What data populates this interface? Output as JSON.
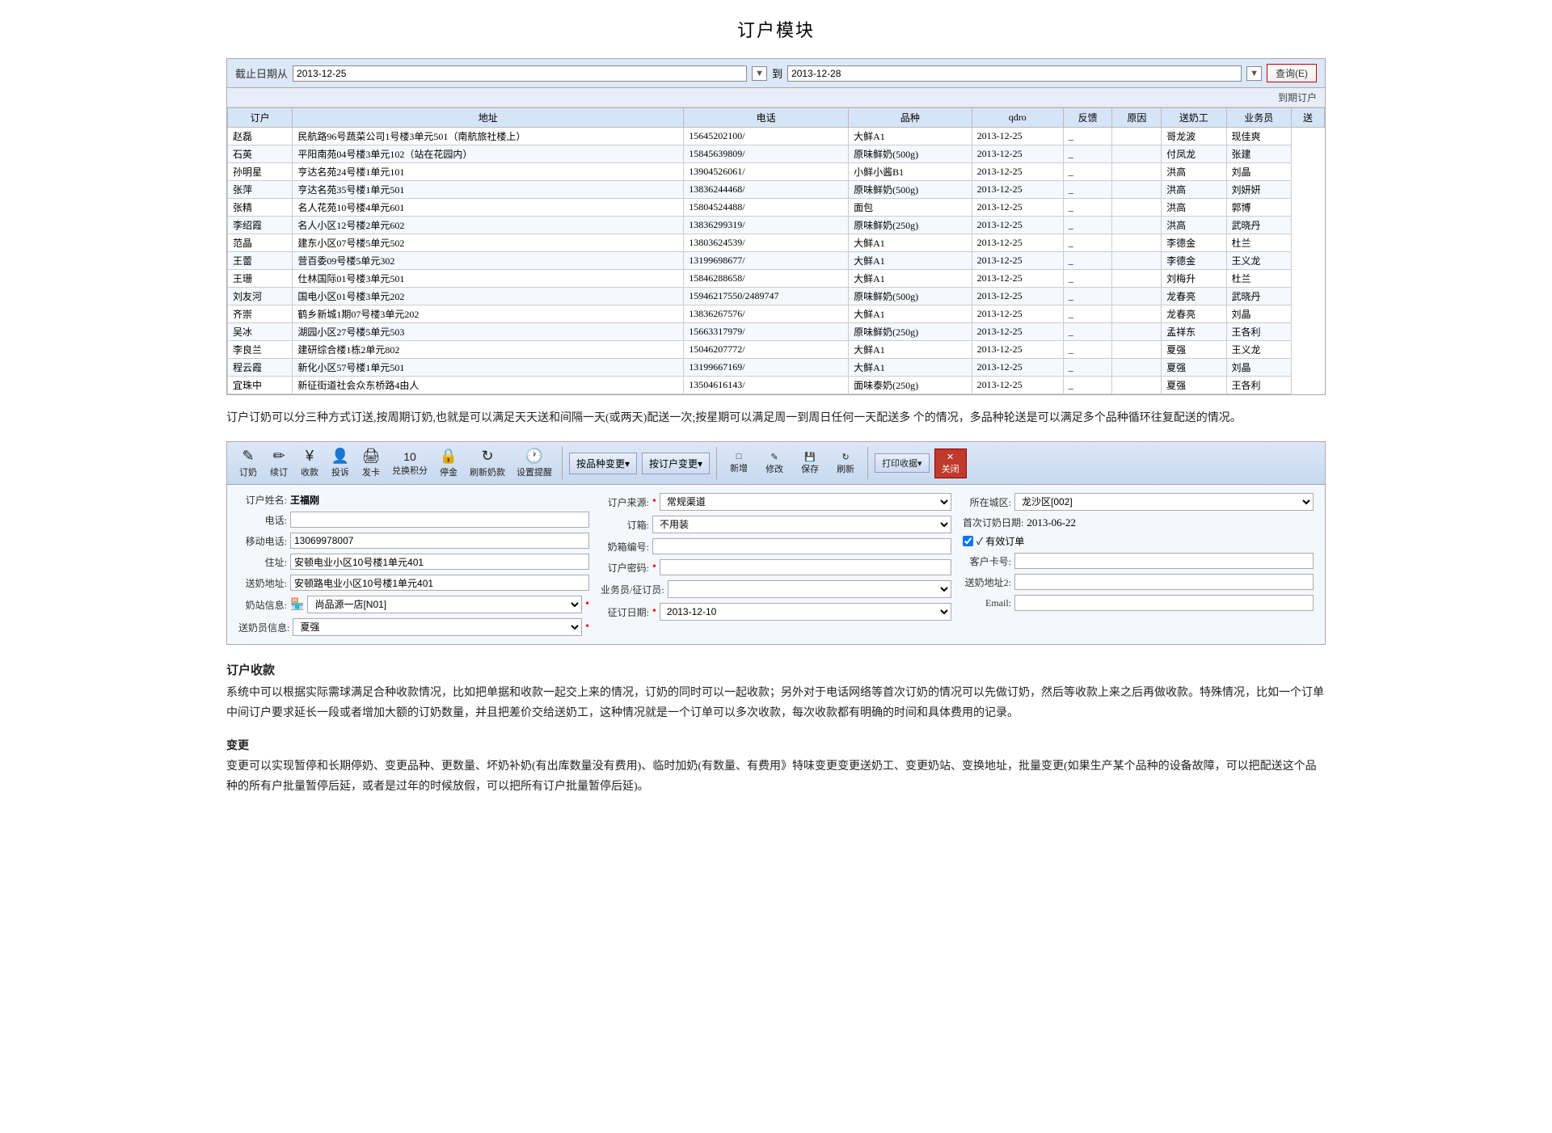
{
  "page": {
    "title": "订户模块"
  },
  "filter": {
    "label": "截止日期从",
    "from_date": "2013-12-25",
    "to_label": "到",
    "to_date": "2013-12-28",
    "query_btn": "查询(E)"
  },
  "table": {
    "subtitle": "到期订户",
    "headers": [
      "订户",
      "地址",
      "电话",
      "品种",
      "qdro",
      "反馈",
      "原因",
      "送奶工",
      "业务员",
      "送"
    ],
    "rows": [
      [
        "赵磊",
        "民航路96号蔬菜公司1号楼3单元501（南航旅社楼上）",
        "15645202100/",
        "大鲜A1",
        "2013-12-25",
        "_",
        "",
        "哥龙波",
        "现佳爽"
      ],
      [
        "石英",
        "平阳南苑04号楼3单元102（站在花园内）",
        "15845639809/",
        "原味鲜奶(500g)",
        "2013-12-25",
        "_",
        "",
        "付凤龙",
        "张建"
      ],
      [
        "孙明星",
        "亨达名苑24号楼1单元101",
        "13904526061/",
        "小鲜小酱B1",
        "2013-12-25",
        "_",
        "",
        "洪高",
        "刘晶"
      ],
      [
        "张萍",
        "亨达名苑35号楼1单元501",
        "13836244468/",
        "原味鲜奶(500g)",
        "2013-12-25",
        "_",
        "",
        "洪高",
        "刘妍妍"
      ],
      [
        "张精",
        "名人花苑10号楼4单元601",
        "15804524488/",
        "面包",
        "2013-12-25",
        "_",
        "",
        "洪高",
        "郭博"
      ],
      [
        "李绍霞",
        "名人小区12号楼2单元602",
        "13836299319/",
        "原味鲜奶(250g)",
        "2013-12-25",
        "_",
        "",
        "洪高",
        "武晓丹"
      ],
      [
        "范晶",
        "建东小区07号楼5单元502",
        "13803624539/",
        "大鲜A1",
        "2013-12-25",
        "_",
        "",
        "李德金",
        "杜兰"
      ],
      [
        "王蕾",
        "营百委09号楼5单元302",
        "13199698677/",
        "大鲜A1",
        "2013-12-25",
        "_",
        "",
        "李德金",
        "王义龙"
      ],
      [
        "王珊",
        "仕林国际01号楼3单元501",
        "15846288658/",
        "大鲜A1",
        "2013-12-25",
        "_",
        "",
        "刘梅升",
        "杜兰"
      ],
      [
        "刘友河",
        "国电小区01号楼3单元202",
        "15946217550/2489747",
        "原味鲜奶(500g)",
        "2013-12-25",
        "_",
        "",
        "龙春亮",
        "武晓丹"
      ],
      [
        "齐崇",
        "鹤乡新城1期07号楼3单元202",
        "13836267576/",
        "大鲜A1",
        "2013-12-25",
        "_",
        "",
        "龙春亮",
        "刘晶"
      ],
      [
        "吴冰",
        "湖园小区27号楼5单元503",
        "15663317979/",
        "原味鲜奶(250g)",
        "2013-12-25",
        "_",
        "",
        "孟祥东",
        "王各利"
      ],
      [
        "李良兰",
        "建研综合楼1栋2单元802",
        "15046207772/",
        "大鲜A1",
        "2013-12-25",
        "_",
        "",
        "夏强",
        "王义龙"
      ],
      [
        "程云霞",
        "新化小区57号楼1单元501",
        "13199667169/",
        "大鲜A1",
        "2013-12-25",
        "_",
        "",
        "夏强",
        "刘晶"
      ],
      [
        "宜珠中",
        "新征街道社会众东桥路4由人",
        "13504616143/",
        "面味泰奶(250g)",
        "2013-12-25",
        "_",
        "",
        "夏强",
        "王各利"
      ]
    ]
  },
  "desc1": "订户订奶可以分三种方式订送,按周期订奶,也就是可以满足天天送和间隔一天(或两天)配送一次;按星期可以满足周一到周日任何一天配送多 个的情况，多品种轮送是可以满足多个品种循环往复配送的情况。",
  "toolbar": {
    "btn_subscribe": "订奶",
    "btn_unsubscribe": "续订",
    "btn_collect": "收款",
    "btn_invest": "投诉",
    "btn_invoice": "发卡",
    "btn_exchange": "兑换积分",
    "btn_hold": "停金",
    "btn_refresh": "刷新奶款",
    "btn_settings": "设置提醒",
    "btn_change_variety": "按品种变更▾",
    "btn_change_order": "按订户变更▾",
    "btn_new": "新增",
    "btn_edit": "修改",
    "btn_save": "保存",
    "btn_refresh2": "刷新",
    "btn_print": "打印收据▾",
    "btn_close": "关闭"
  },
  "form": {
    "name_label": "订户姓名:",
    "name_value": "王福刚",
    "phone_label": "电话:",
    "phone_value": "",
    "mobile_label": "移动电话:",
    "mobile_value": "13069978007",
    "address_label": "住址:",
    "address_value": "安顿电业小区10号楼1单元401",
    "delivery_label": "送奶地址:",
    "delivery_value": "安顿路电业小区10号楼1单元401",
    "station_label": "奶站信息:",
    "station_icon": "🏪",
    "station_value": "尚品源一店[N01]",
    "delivery_person_label": "送奶员信息:",
    "delivery_person_value": "夏强",
    "source_label": "订户来源:",
    "source_value": "常规渠道",
    "box_label": "订箱:",
    "box_value": "不用装",
    "milk_code_label": "奶箱编号:",
    "milk_code_value": "",
    "customer_code_label": "订户密码:",
    "customer_code_value": "",
    "salesperson_label": "业务员/征订员:",
    "salesperson_value": "",
    "subscribe_date_label": "征订日期:",
    "subscribe_date_value": "2013-12-10",
    "city_label": "所在城区:",
    "city_value": "龙沙区[002]",
    "first_order_label": "首次订奶日期:",
    "first_order_value": "2013-06-22",
    "valid_order_label": "✓ 有效订单",
    "customer_card_label": "客户卡号:",
    "customer_card_value": "",
    "delivery_address2_label": "送奶地址2:",
    "delivery_address2_value": "",
    "email_label": "Email:",
    "email_value": "",
    "required_dot": "•"
  },
  "sections": {
    "collect_title": "订户收款",
    "collect_desc": "系统中可以根据实际需球满足合种收款情况，比如把单据和收款一起交上来的情况，订奶的同时可以一起收款；另外对于电话网络等首次订奶的情况可以先做订奶，然后等收款上来之后再做收款。特殊情况，比如一个订单中间订户要求延长一段或者增加大额的订奶数量，并且把差价交给送奶工，这种情况就是一个订单可以多次收款，每次收款都有明确的时间和具体费用的记录。",
    "change_title": "变更",
    "change_desc": "变更可以实现暂停和长期停奶、变更品种、更数量、坏奶补奶(有出库数量没有费用)、临时加奶(有数量、有费用》特味变更变更送奶工、变更奶站、变换地址，批量变更(如果生产某个品种的设备故障，可以把配送这个品种的所有户批量暂停后延，或者是过年的时候放假，可以把所有订户批量暂停后延)。"
  }
}
